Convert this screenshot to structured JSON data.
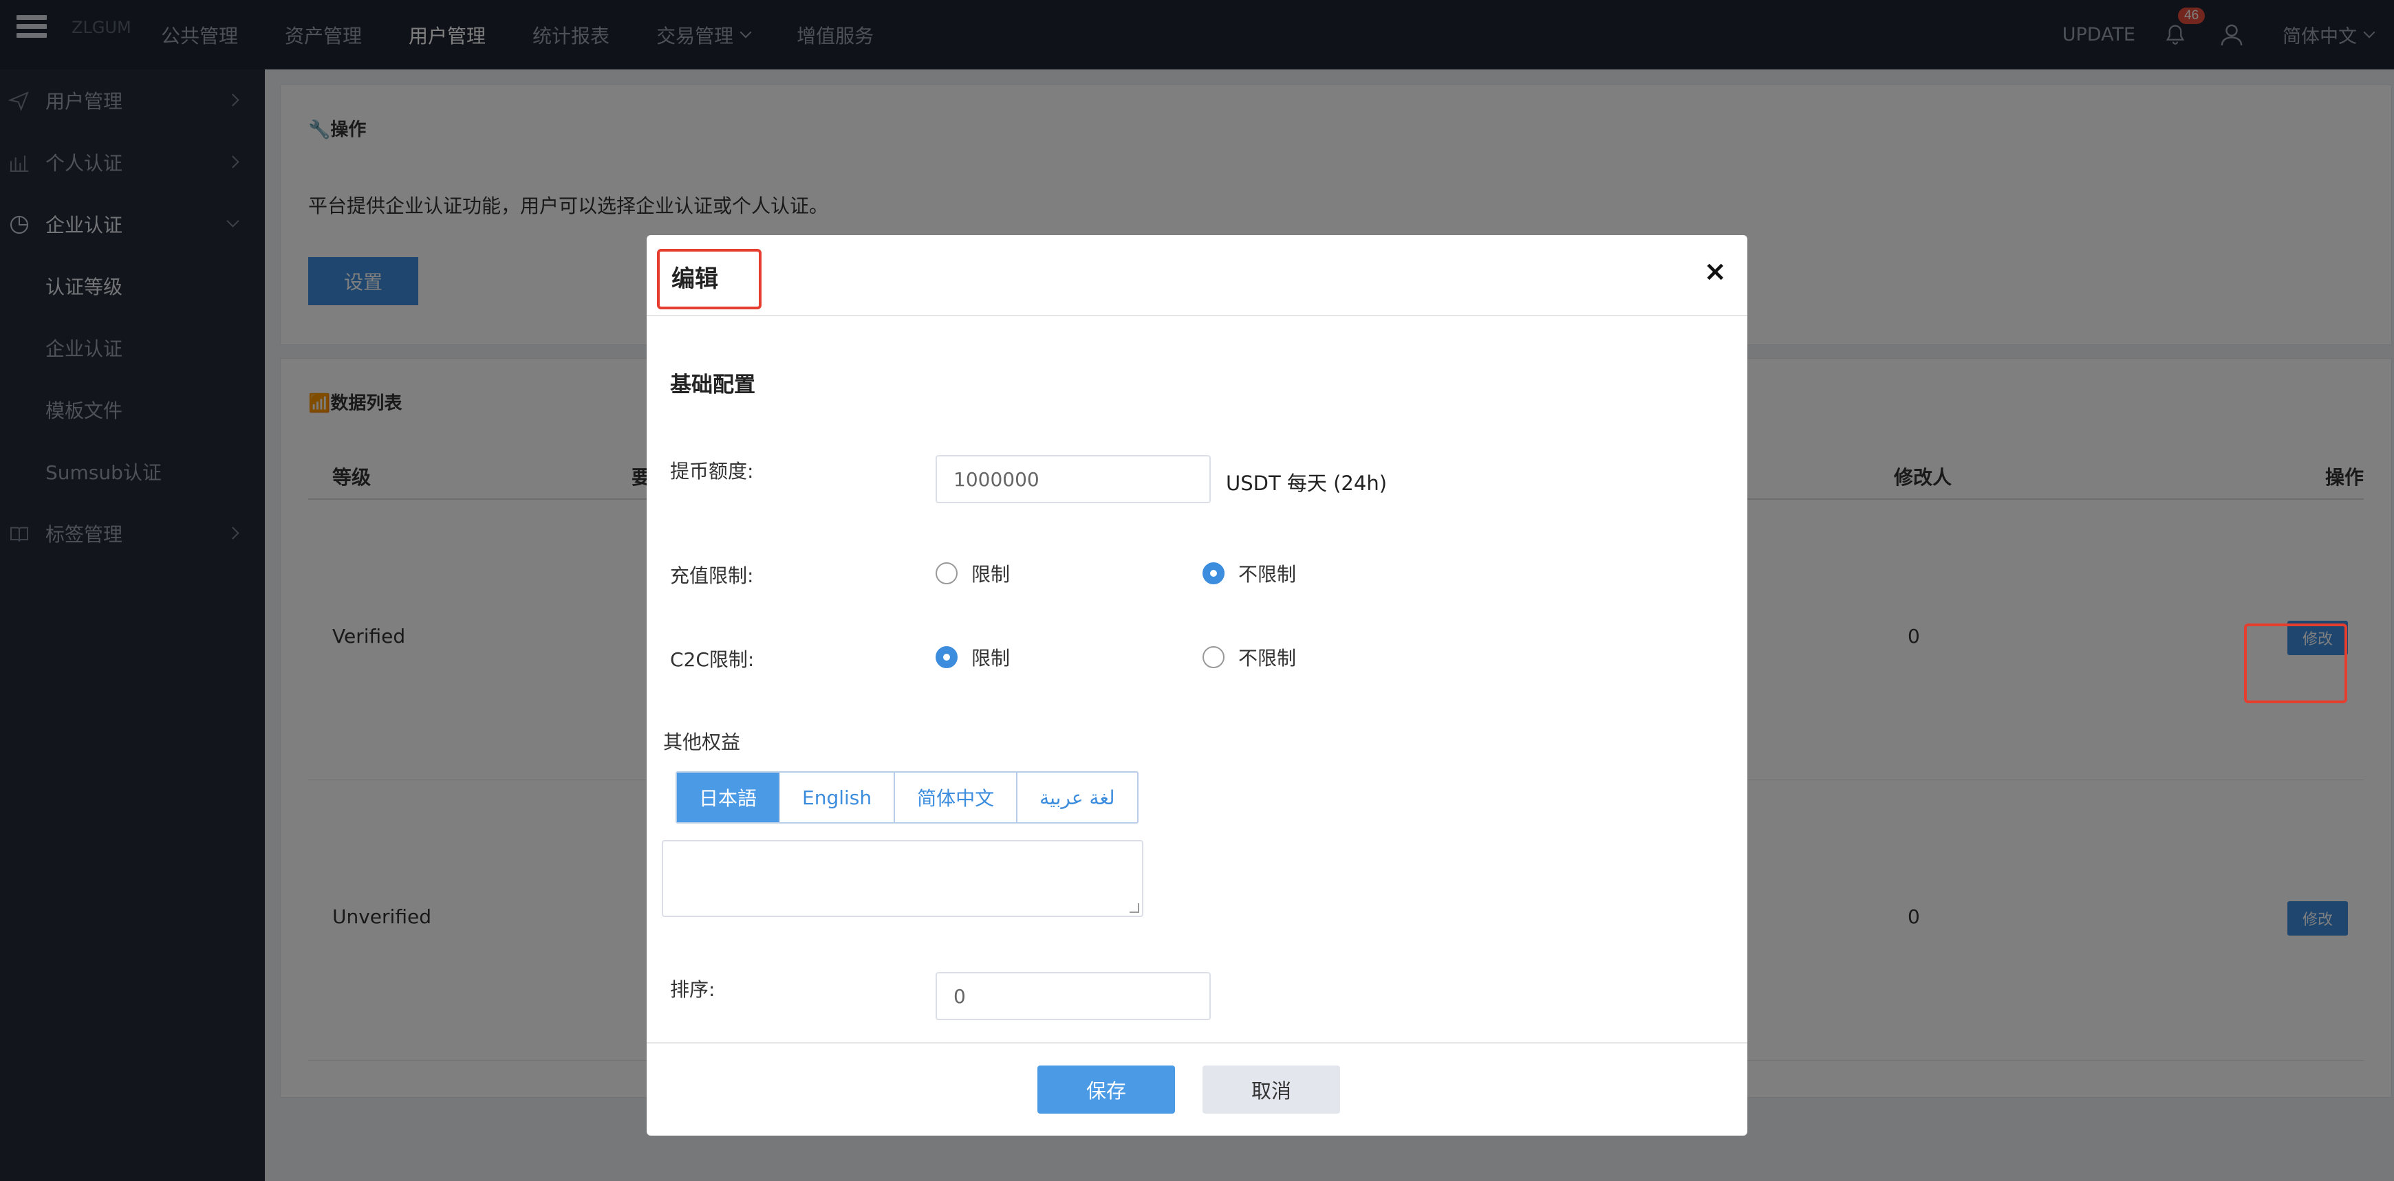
{
  "topbar": {
    "logo": "ZLGUM",
    "nav": [
      "公共管理",
      "资产管理",
      "用户管理",
      "统计报表",
      "交易管理",
      "增值服务"
    ],
    "active_nav": "用户管理",
    "update": "UPDATE",
    "notifications": "46",
    "language": "简体中文"
  },
  "sidebar": {
    "items": [
      {
        "label": "用户管理",
        "icon": "send-icon"
      },
      {
        "label": "个人认证",
        "icon": "bar-chart-icon"
      },
      {
        "label": "企业认证",
        "icon": "pie-chart-icon"
      }
    ],
    "sub_items": [
      "认证等级",
      "企业认证",
      "模板文件",
      "Sumsub认证"
    ],
    "last_item": {
      "label": "标签管理",
      "icon": "book-icon"
    }
  },
  "operation_panel": {
    "title": "操作",
    "description": "平台提供企业认证功能，用户可以选择企业认证或个人认证。",
    "button": "设置"
  },
  "list_panel": {
    "title": "数据列表",
    "columns": [
      "等级",
      "要",
      "修改人",
      "操作"
    ],
    "rows": [
      {
        "level": "Verified",
        "modifier": "0",
        "action": "修改"
      },
      {
        "level": "Unverified",
        "modifier": "0",
        "action": "修改"
      }
    ]
  },
  "modal": {
    "title": "编辑",
    "close": "×",
    "section": "基础配置",
    "withdraw_label": "提币额度:",
    "withdraw_value": "1000000",
    "withdraw_unit": "USDT 每天 (24h)",
    "deposit_label": "充值限制:",
    "deposit_options": [
      "限制",
      "不限制"
    ],
    "deposit_selected": "不限制",
    "c2c_label": "C2C限制:",
    "c2c_options": [
      "限制",
      "不限制"
    ],
    "c2c_selected": "限制",
    "other_label": "其他权益",
    "lang_tabs": [
      "日本語",
      "English",
      "简体中文",
      "لغة عربية"
    ],
    "active_tab": "日本語",
    "sort_label": "排序:",
    "sort_value": "0",
    "save": "保存",
    "cancel": "取消"
  },
  "colors": {
    "topbar": "#1f2532",
    "sidebar": "#242a37",
    "primary": "#3c8dde",
    "highlight": "#e53d2e",
    "badge": "#e74c3c"
  }
}
